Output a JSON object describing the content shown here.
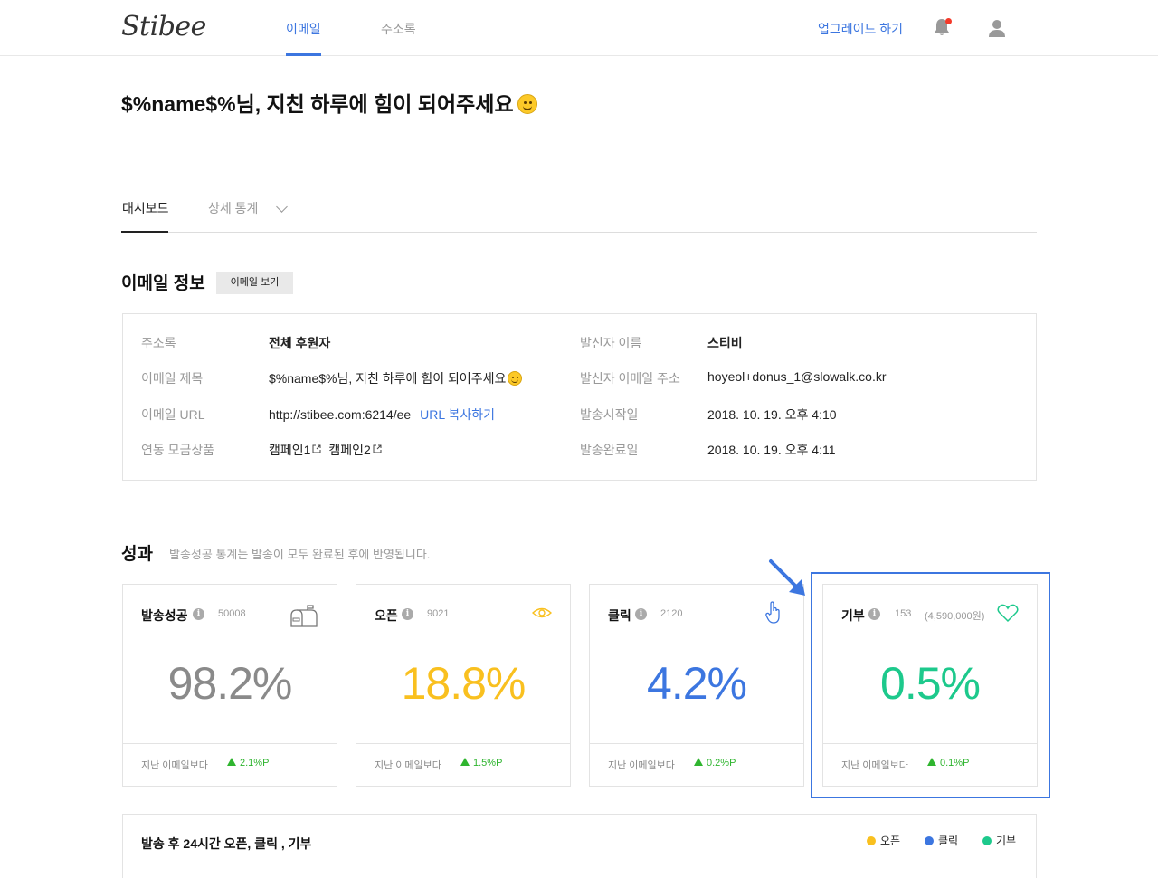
{
  "header": {
    "logo": "Stibee",
    "tabs": [
      {
        "label": "이메일",
        "active": true
      },
      {
        "label": "주소록",
        "active": false
      }
    ],
    "upgrade_label": "업그레이드 하기",
    "notification_icon": "bell-icon",
    "user_icon": "user-icon"
  },
  "page": {
    "title": "$%name$%님, 지친 하루에 힘이 되어주세요"
  },
  "subtabs": [
    {
      "label": "대시보드",
      "active": true
    },
    {
      "label": "상세 통계",
      "active": false
    }
  ],
  "email_info": {
    "section_title": "이메일 정보",
    "view_button": "이메일 보기",
    "rows_left": [
      {
        "label": "주소록",
        "value": "전체 후원자"
      },
      {
        "label": "이메일 제목",
        "value": "$%name$%님, 지친 하루에 힘이 되어주세요"
      },
      {
        "label": "이메일 URL",
        "value": "http://stibee.com:6214/ee",
        "link": "URL 복사하기"
      },
      {
        "label": "연동 모금상품",
        "campaigns": [
          "캠페인1",
          "캠페인2"
        ]
      }
    ],
    "rows_right": [
      {
        "label": "발신자 이름",
        "value": "스티비"
      },
      {
        "label": "발신자 이메일 주소",
        "value": "hoyeol+donus_1@slowalk.co.kr"
      },
      {
        "label": "발송시작일",
        "value": "2018. 10. 19. 오후 4:10"
      },
      {
        "label": "발송완료일",
        "value": "2018. 10. 19. 오후 4:11"
      }
    ]
  },
  "performance": {
    "section_title": "성과",
    "note": "발송성공 통계는 발송이 모두 완료된 후에 반영됩니다.",
    "compare_label": "지난 이메일보다",
    "cards": [
      {
        "title": "발송성공",
        "count": "50008",
        "percent": "98.2%",
        "delta": "2.1%P",
        "icon": "mailbox-icon",
        "color": "#8a8a8a"
      },
      {
        "title": "오픈",
        "count": "9021",
        "percent": "18.8%",
        "delta": "1.5%P",
        "icon": "eye-icon",
        "color": "#f9c01f"
      },
      {
        "title": "클릭",
        "count": "2120",
        "percent": "4.2%",
        "delta": "0.2%P",
        "icon": "hand-pointer-icon",
        "color": "#3c76e0"
      },
      {
        "title": "기부",
        "count": "153",
        "extra": "(4,590,000원)",
        "percent": "0.5%",
        "delta": "0.1%P",
        "icon": "heart-icon",
        "color": "#1dc98c"
      }
    ]
  },
  "chart24": {
    "title_prefix": "발송 후 ",
    "title_bold": "24",
    "title_suffix": "시간 오픈, 클릭 , 기부",
    "legend": [
      {
        "label": "오픈",
        "color": "#f9c01f"
      },
      {
        "label": "클릭",
        "color": "#3c76e0"
      },
      {
        "label": "기부",
        "color": "#1dc98c"
      }
    ]
  }
}
